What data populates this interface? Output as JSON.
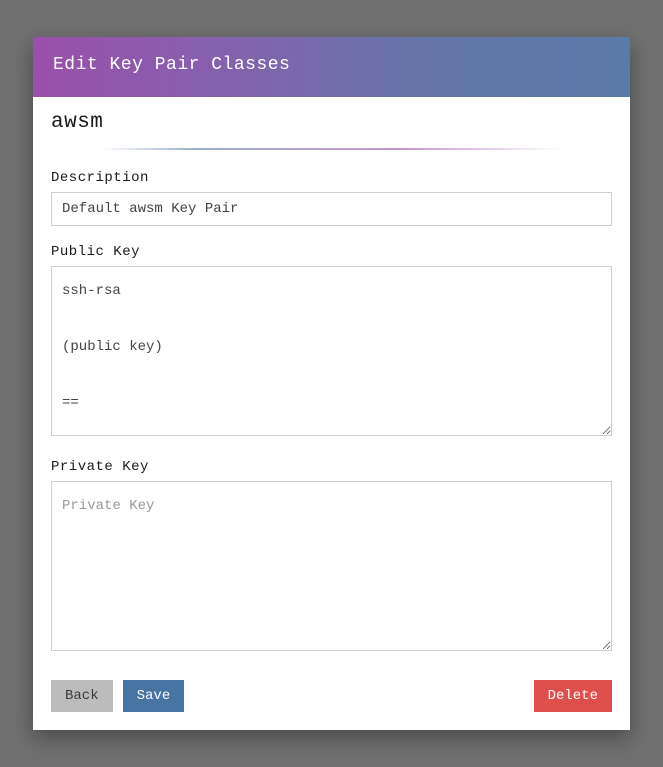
{
  "header": {
    "title": "Edit Key Pair Classes"
  },
  "form": {
    "name": "awsm",
    "description": {
      "label": "Description",
      "value": "Default awsm Key Pair"
    },
    "public_key": {
      "label": "Public Key",
      "value": "ssh-rsa\n\n(public key)\n\n=="
    },
    "private_key": {
      "label": "Private Key",
      "value": "",
      "placeholder": "Private Key"
    }
  },
  "buttons": {
    "back": "Back",
    "save": "Save",
    "delete": "Delete"
  }
}
